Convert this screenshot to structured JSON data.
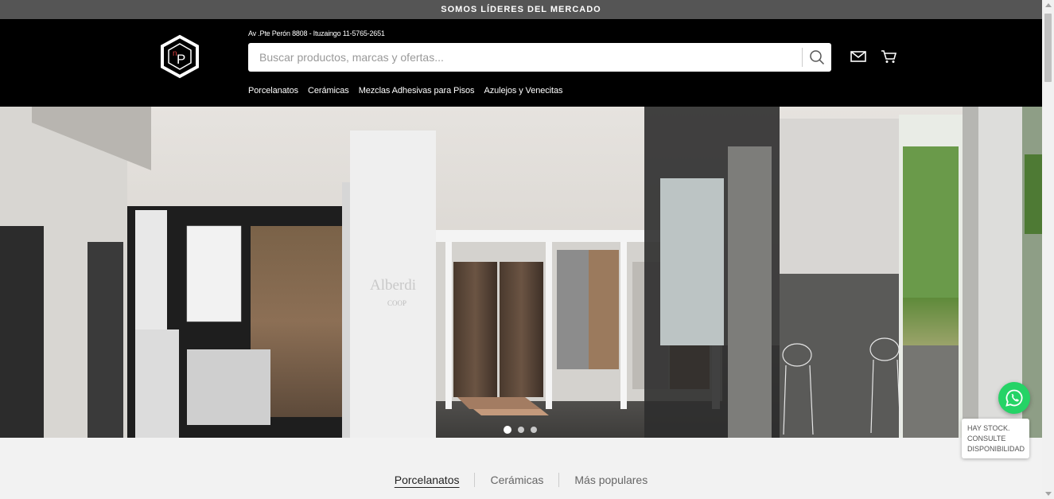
{
  "topbar": {
    "text": "SOMOS LÍDERES DEL MERCADO"
  },
  "header": {
    "logo_letters": "nP",
    "address": "Av .Pte Perón 8808 - Ituzaingo 11-5765-2651",
    "search": {
      "placeholder": "Buscar productos, marcas y ofertas...",
      "value": "",
      "icon": "search-icon"
    },
    "icons": [
      "mail-icon",
      "cart-icon"
    ],
    "nav": [
      "Porcelanatos",
      "Cerámicas",
      "Mezclas Adhesivas para Pisos",
      "Azulejos y Venecitas"
    ]
  },
  "hero": {
    "sign_text": "Alberdi",
    "sign_sub": "COOP",
    "slides_count": 3,
    "active_slide": 1
  },
  "tabs": [
    {
      "label": "Porcelanatos",
      "active": true
    },
    {
      "label": "Cerámicas",
      "active": false
    },
    {
      "label": "Más populares",
      "active": false
    }
  ],
  "whatsapp": {
    "icon": "whatsapp-icon",
    "tooltip_line1": "HAY STOCK.",
    "tooltip_line2": "CONSULTE",
    "tooltip_line3": "DISPONIBILIDAD",
    "color": "#25d366"
  },
  "colors": {
    "header_bg": "#000000",
    "topbar_bg": "#555555",
    "page_bg": "#f2f2f2"
  }
}
